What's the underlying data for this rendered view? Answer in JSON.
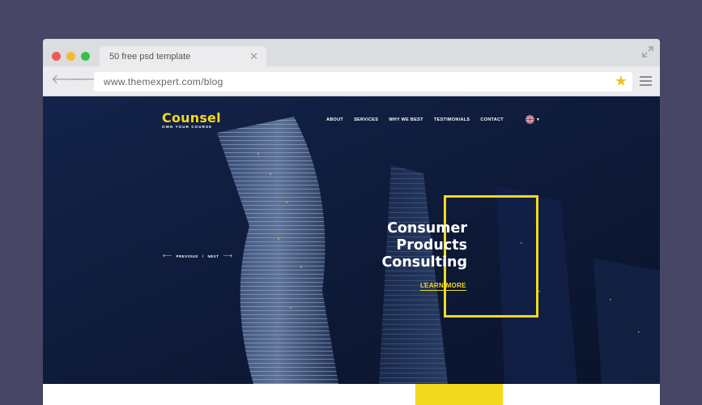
{
  "browser": {
    "tab": {
      "title": "50 free psd  template",
      "close_glyph": "✕"
    },
    "url": "www.themexpert.com/blog",
    "icons": {
      "back": "arrow-left-icon",
      "forward": "arrow-right-icon",
      "bookmark": "star-icon",
      "menu": "hamburger-menu-icon",
      "expand": "expand-icon"
    },
    "colors": {
      "close": "#ee5a53",
      "minimize": "#f4bb30",
      "maximize": "#35c04a",
      "star": "#f2c029"
    }
  },
  "site": {
    "logo": {
      "name": "Counsel",
      "tagline": "OWN YOUR COURSE"
    },
    "nav": [
      "ABOUT",
      "SERVICES",
      "WHY WE BEST",
      "TESTIMONIALS",
      "CONTACT"
    ],
    "language_icon": "uk-flag-icon",
    "slider": {
      "prev": "PREVIOUS",
      "separator": "/",
      "next": "NEXT"
    },
    "hero": {
      "headline": [
        "Consumer",
        "Products",
        "Consulting"
      ],
      "cta": "LEARN MORE"
    },
    "colors": {
      "accent": "#f2d91e",
      "hero_background": "#0e1a38",
      "page_background": "#474665"
    }
  }
}
